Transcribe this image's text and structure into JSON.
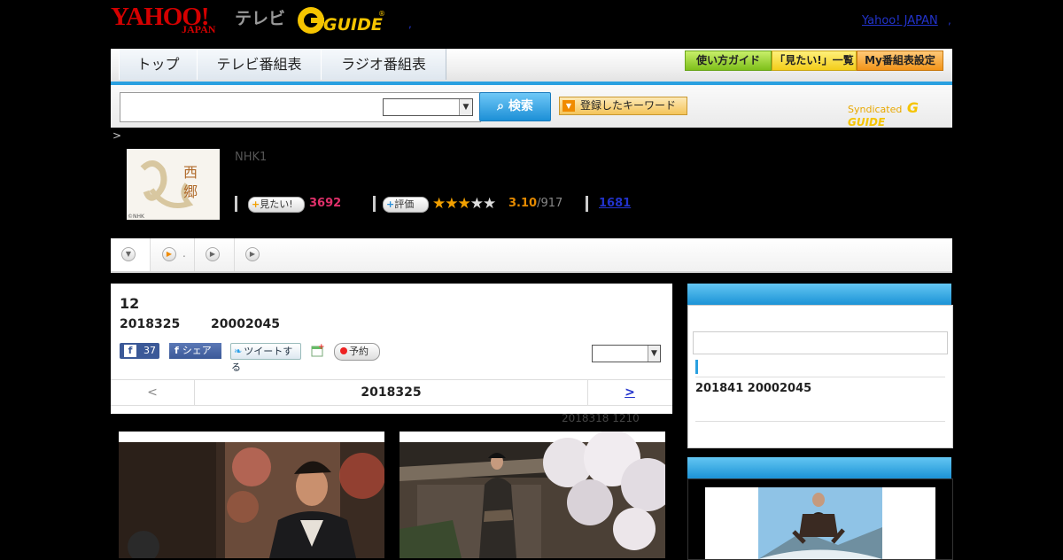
{
  "header": {
    "logo_yahoo": "YAHOO!",
    "logo_japan": "JAPAN",
    "logo_tv": "テレビ",
    "logo_gguide": "GUIDE",
    "gguide_mark": "G",
    "yahoo_japan_link": "Yahoo! JAPAN",
    "dot_right": ",",
    "dot_mid": ","
  },
  "nav": {
    "tabs": [
      {
        "label": "トップ"
      },
      {
        "label": "テレビ番組表"
      },
      {
        "label": "ラジオ番組表"
      }
    ],
    "buttons": [
      {
        "label": "使い方ガイド"
      },
      {
        "label": "「見たい!」一覧"
      },
      {
        "label": "My番組表設定"
      }
    ]
  },
  "search": {
    "input_value": "",
    "select_value": "",
    "button_label": "検索",
    "keyword_button_label": "登録したキーワード",
    "syndicated_label": "Syndicated"
  },
  "breadcrumb": ">",
  "program": {
    "channel": "NHK1",
    "thumb_text_1": "西",
    "thumb_text_2": "郷",
    "thumb_credit": "©NHK",
    "want_label": "見たい!",
    "want_count": "3692",
    "rating_button": "評価",
    "rating_value": "3.10",
    "rating_count": "/917",
    "rating_stars": 3.1,
    "link_count": "1681"
  },
  "tabbar": {
    "tab2_suffix": "."
  },
  "episode": {
    "number": "12",
    "date": "2018325",
    "time": "20002045",
    "like_count": "37",
    "share_label": "シェア",
    "tweet_label": "ツイートする",
    "reserve_label": "予約",
    "select_value": "",
    "prev_label": "<",
    "nav_date": "2018325",
    "next_label": ">",
    "updated": "2018318  1210"
  },
  "side": {
    "next_broadcast": "201841  20002045"
  },
  "colors": {
    "accent_blue": "#1c93d6",
    "want_pink": "#e0306a",
    "rating_orange": "#e58a00"
  }
}
